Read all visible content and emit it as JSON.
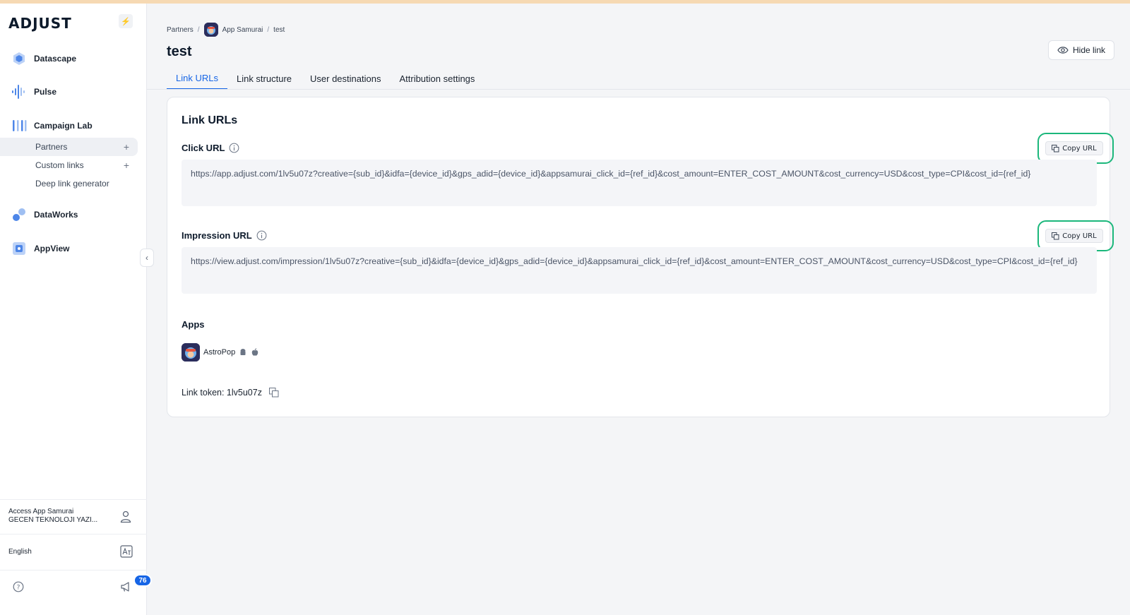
{
  "brand": {
    "logo": "ADJUST"
  },
  "sidebar": {
    "items": [
      {
        "label": "Datascape",
        "icon": "datascape-icon"
      },
      {
        "label": "Pulse",
        "icon": "pulse-icon"
      },
      {
        "label": "Campaign Lab",
        "icon": "campaign-lab-icon"
      },
      {
        "label": "DataWorks",
        "icon": "dataworks-icon"
      },
      {
        "label": "AppView",
        "icon": "appview-icon"
      }
    ],
    "subitems": [
      {
        "label": "Partners",
        "plus": "+"
      },
      {
        "label": "Custom links",
        "plus": "+"
      },
      {
        "label": "Deep link generator"
      }
    ],
    "account_line1": "Access App Samurai",
    "account_line2": "GECEN TEKNOLOJI YAZI...",
    "language": "English",
    "notification_count": "76"
  },
  "breadcrumb": {
    "root": "Partners",
    "partner": "App Samurai",
    "current": "test"
  },
  "page": {
    "title": "test",
    "hide_link_label": "Hide link"
  },
  "tabs": [
    "Link URLs",
    "Link structure",
    "User destinations",
    "Attribution settings"
  ],
  "card": {
    "title": "Link URLs",
    "click_label": "Click URL",
    "click_url": "https://app.adjust.com/1lv5u07z?creative={sub_id}&idfa={device_id}&gps_adid={device_id}&appsamurai_click_id={ref_id}&cost_amount=ENTER_COST_AMOUNT&cost_currency=USD&cost_type=CPI&cost_id={ref_id}",
    "impression_label": "Impression URL",
    "impression_url": "https://view.adjust.com/impression/1lv5u07z?creative={sub_id}&idfa={device_id}&gps_adid={device_id}&appsamurai_click_id={ref_id}&cost_amount=ENTER_COST_AMOUNT&cost_currency=USD&cost_type=CPI&cost_id={ref_id}",
    "copy_label": "Copy URL",
    "apps_label": "Apps",
    "app_name": "AstroPop",
    "token_text": "Link token: 1lv5u07z"
  },
  "colors": {
    "accent": "#1665e6",
    "highlight": "#1bb77b"
  }
}
